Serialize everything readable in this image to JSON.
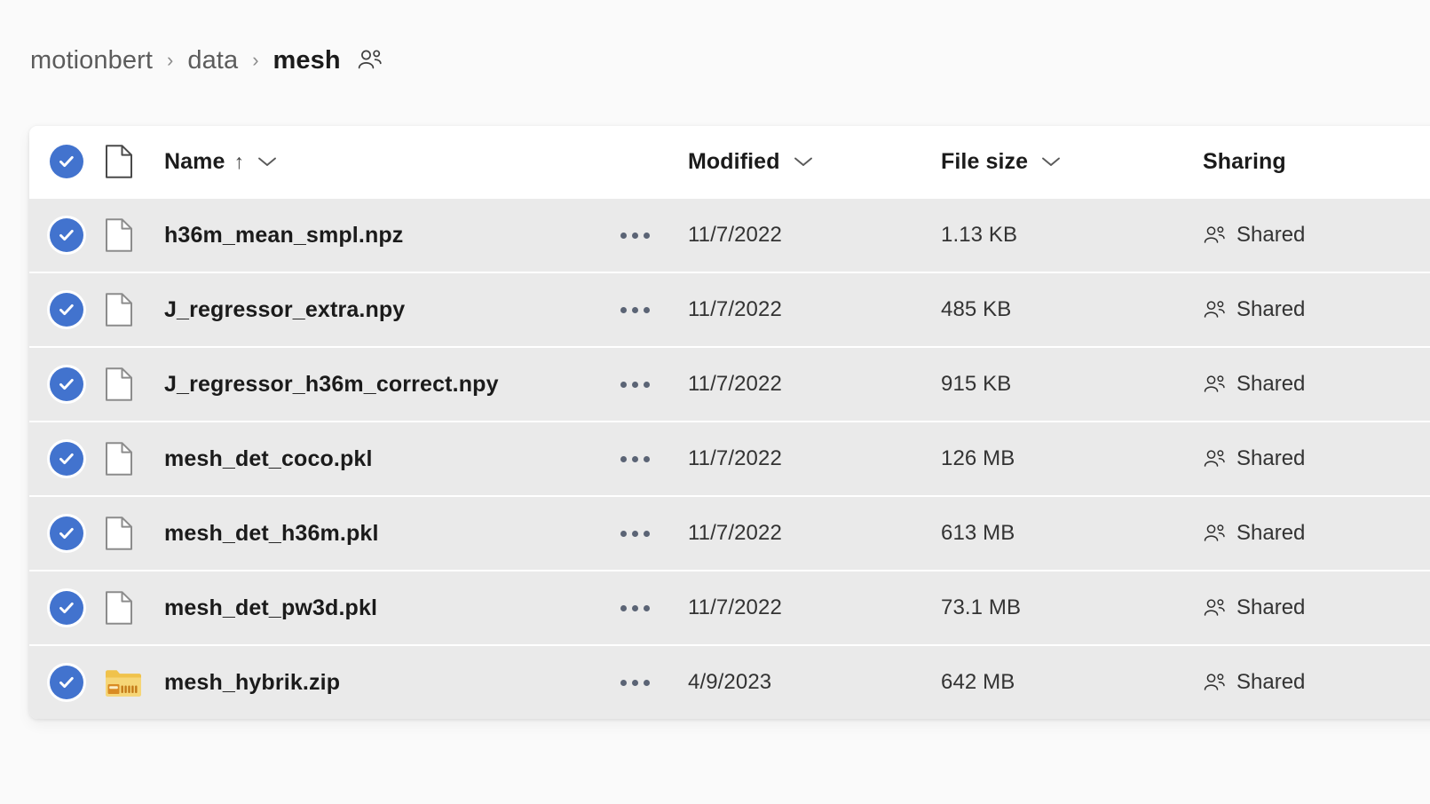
{
  "breadcrumb": {
    "items": [
      {
        "label": "motionbert",
        "current": false
      },
      {
        "label": "data",
        "current": false
      },
      {
        "label": "mesh",
        "current": true
      }
    ],
    "separator": "›",
    "shared_icon": "people-icon"
  },
  "colors": {
    "accent": "#4273ce",
    "page_background": "#fafafa",
    "header_background": "#ffffff",
    "row_selected_background": "#eaeaea",
    "text_primary": "#1b1b1b",
    "text_secondary": "#333333",
    "zip_folder": "#f3cd6a"
  },
  "file_list": {
    "select_all": {
      "checked": true,
      "icon": "check-circle-icon"
    },
    "type_column_icon": "file-type-icon",
    "columns": [
      {
        "key": "name",
        "label": "Name",
        "sorted": true,
        "sort_direction": "↑",
        "has_chevron": true
      },
      {
        "key": "modified",
        "label": "Modified",
        "sorted": false,
        "has_chevron": true
      },
      {
        "key": "size",
        "label": "File size",
        "sorted": false,
        "has_chevron": true
      },
      {
        "key": "sharing",
        "label": "Sharing",
        "sorted": false,
        "has_chevron": false
      }
    ],
    "row_menu_icon": "ellipsis-icon",
    "rows": [
      {
        "selected": true,
        "icon": "file-icon",
        "name": "h36m_mean_smpl.npz",
        "modified": "11/7/2022",
        "size": "1.13 KB",
        "sharing": "Shared",
        "sharing_icon": "people-icon"
      },
      {
        "selected": true,
        "icon": "file-icon",
        "name": "J_regressor_extra.npy",
        "modified": "11/7/2022",
        "size": "485 KB",
        "sharing": "Shared",
        "sharing_icon": "people-icon"
      },
      {
        "selected": true,
        "icon": "file-icon",
        "name": "J_regressor_h36m_correct.npy",
        "modified": "11/7/2022",
        "size": "915 KB",
        "sharing": "Shared",
        "sharing_icon": "people-icon"
      },
      {
        "selected": true,
        "icon": "file-icon",
        "name": "mesh_det_coco.pkl",
        "modified": "11/7/2022",
        "size": "126 MB",
        "sharing": "Shared",
        "sharing_icon": "people-icon"
      },
      {
        "selected": true,
        "icon": "file-icon",
        "name": "mesh_det_h36m.pkl",
        "modified": "11/7/2022",
        "size": "613 MB",
        "sharing": "Shared",
        "sharing_icon": "people-icon"
      },
      {
        "selected": true,
        "icon": "file-icon",
        "name": "mesh_det_pw3d.pkl",
        "modified": "11/7/2022",
        "size": "73.1 MB",
        "sharing": "Shared",
        "sharing_icon": "people-icon"
      },
      {
        "selected": true,
        "icon": "zip-folder-icon",
        "name": "mesh_hybrik.zip",
        "modified": "4/9/2023",
        "size": "642 MB",
        "sharing": "Shared",
        "sharing_icon": "people-icon"
      }
    ]
  }
}
